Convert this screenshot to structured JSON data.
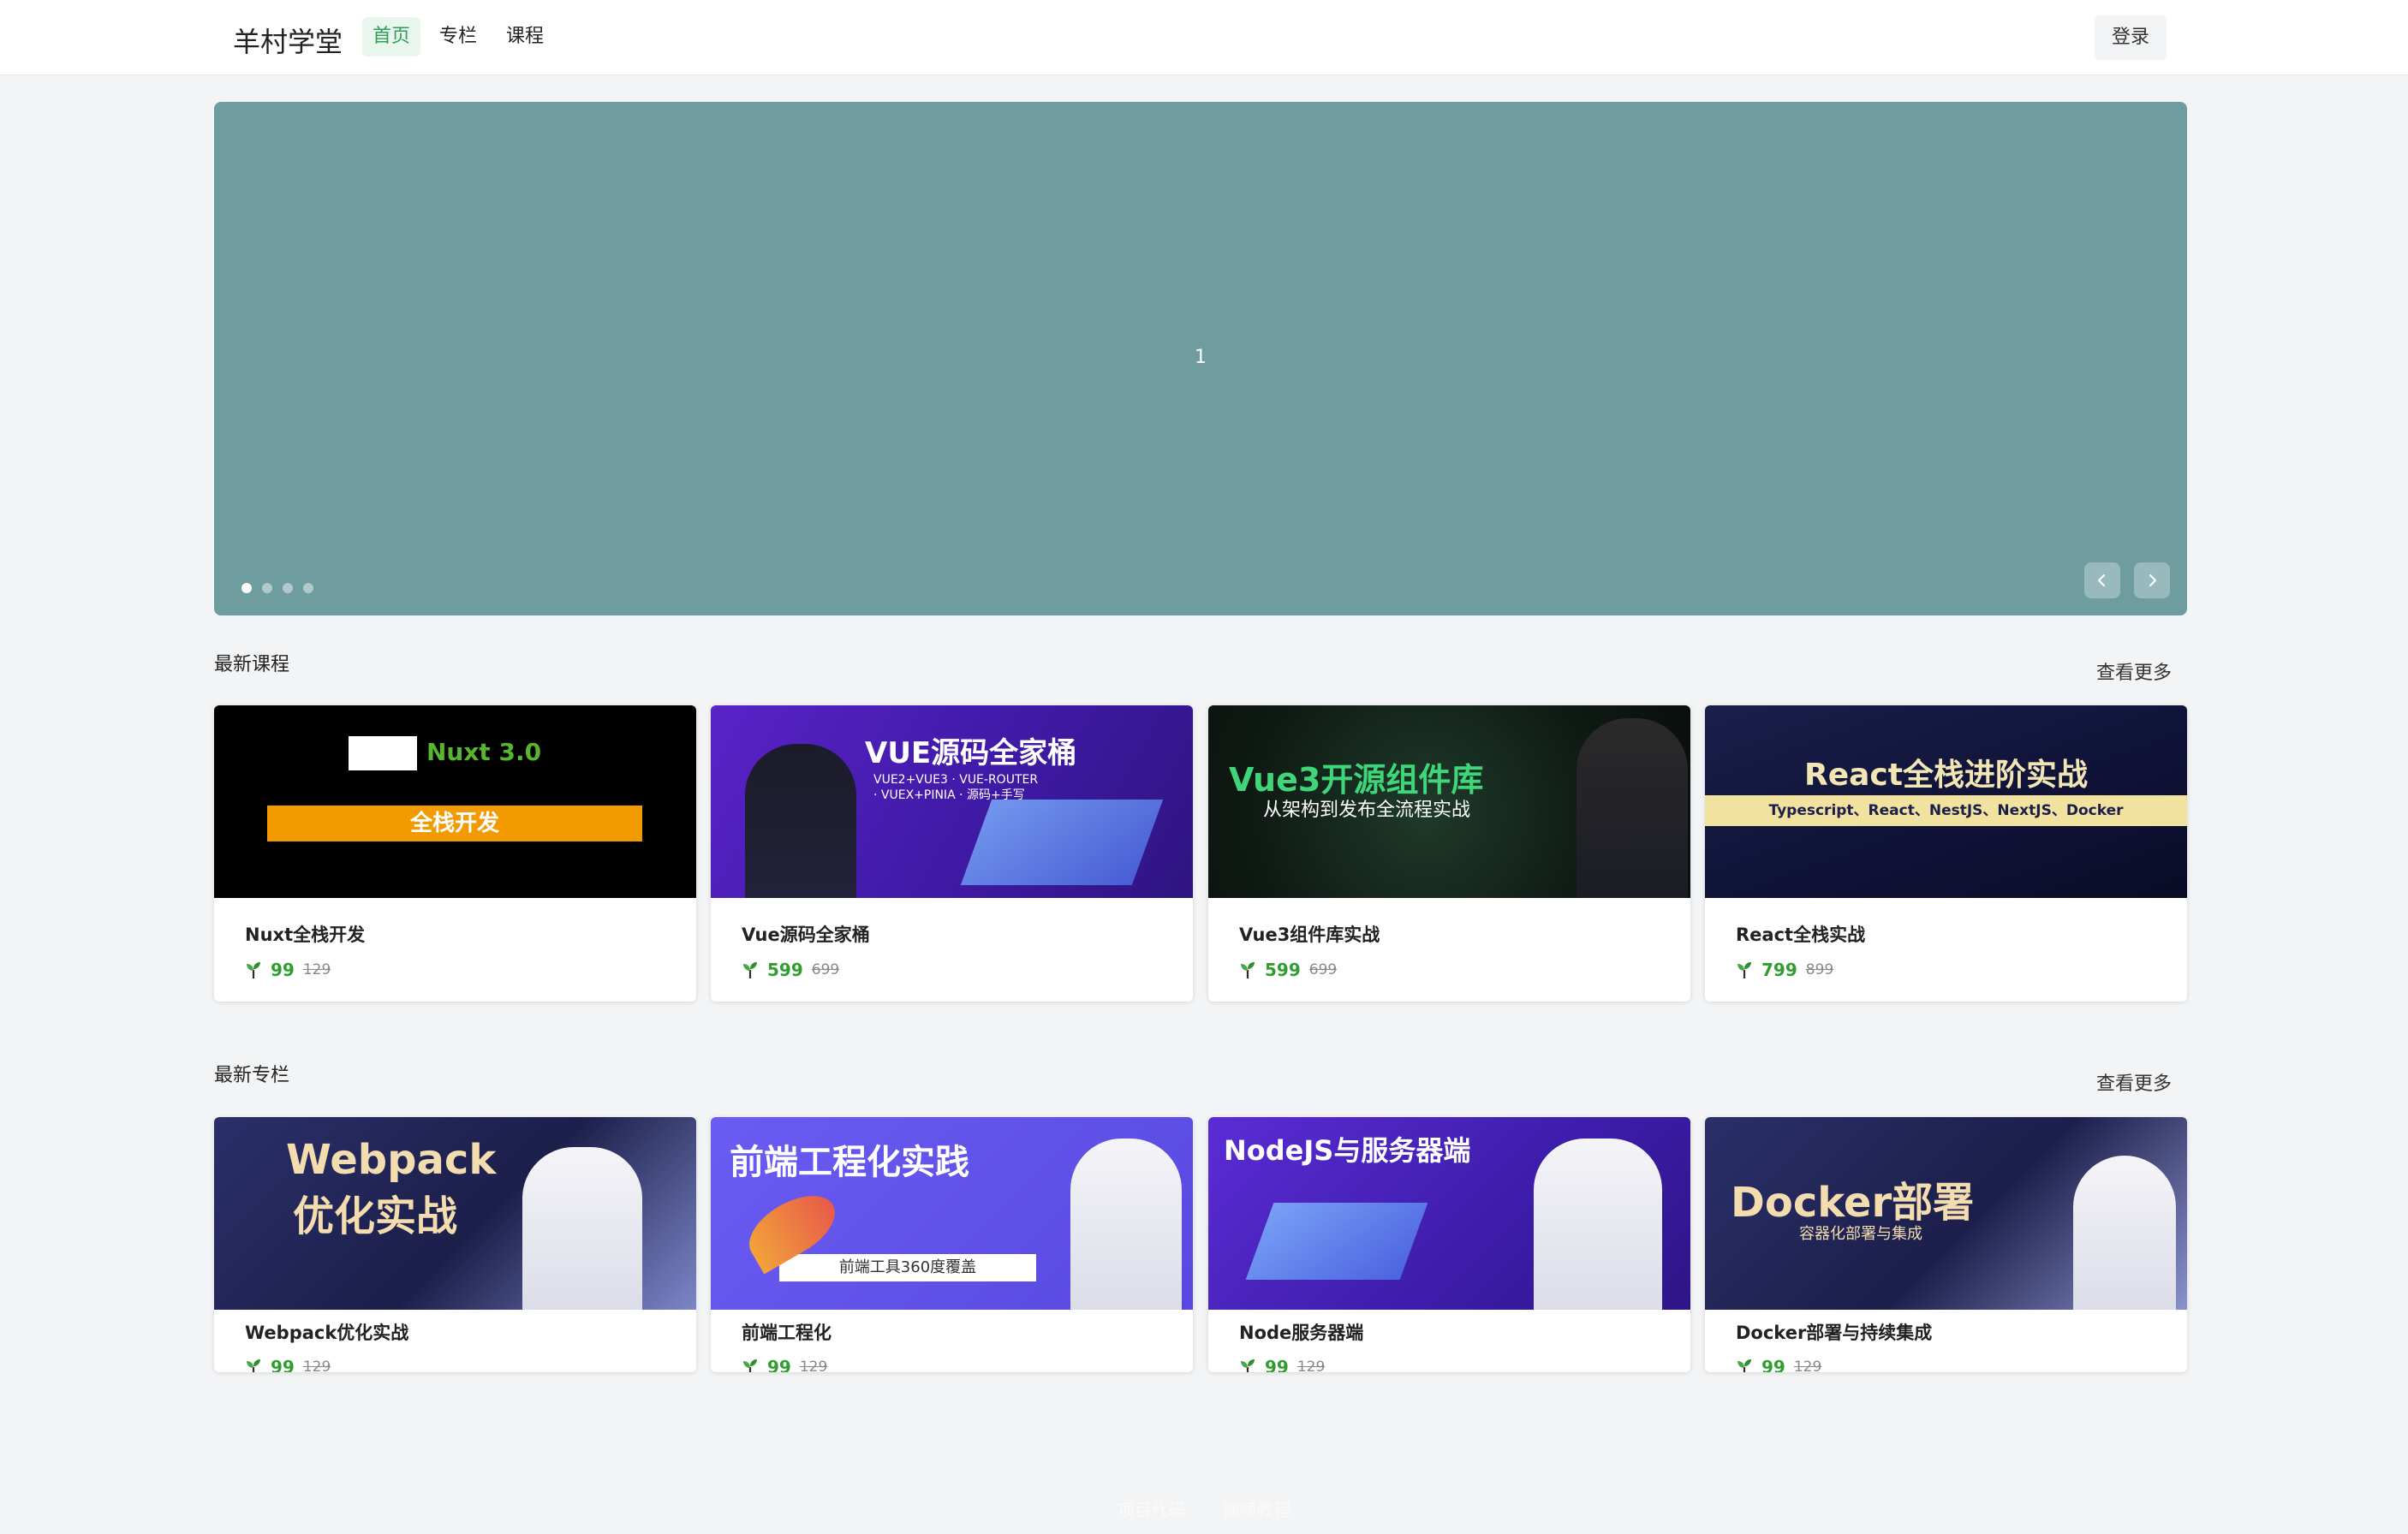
{
  "header": {
    "brand": "羊村学堂",
    "nav": [
      {
        "label": "首页",
        "active": true
      },
      {
        "label": "专栏",
        "active": false
      },
      {
        "label": "课程",
        "active": false
      }
    ],
    "login_label": "登录"
  },
  "carousel": {
    "slide_number": "1",
    "dot_count": 4,
    "active_dot": 0,
    "prev_icon": "chevron-left-icon",
    "next_icon": "chevron-right-icon",
    "background": "#6e9c9f"
  },
  "courses": {
    "title": "最新课程",
    "more_label": "查看更多",
    "items": [
      {
        "name": "Nuxt全栈开发",
        "price": "99",
        "old_price": "129",
        "thumb_line1": "Nuxt 3.0",
        "thumb_line2": "全栈开发"
      },
      {
        "name": "Vue源码全家桶",
        "price": "599",
        "old_price": "699",
        "thumb_line1": "VUE源码全家桶",
        "thumb_line2": "VUE2+VUE3 · VUE-ROUTER · VUEX+PINIA · 源码+手写"
      },
      {
        "name": "Vue3组件库实战",
        "price": "599",
        "old_price": "699",
        "thumb_line1": "Vue3开源组件库",
        "thumb_line2": "从架构到发布全流程实战"
      },
      {
        "name": "React全栈实战",
        "price": "799",
        "old_price": "899",
        "thumb_line1": "React全栈进阶实战",
        "thumb_line2": "Typescript、React、NestJS、NextJS、Docker"
      }
    ]
  },
  "columns": {
    "title": "最新专栏",
    "more_label": "查看更多",
    "items": [
      {
        "name": "Webpack优化实战",
        "price": "99",
        "old_price": "129",
        "thumb_line1": "Webpack",
        "thumb_line2": "优化实战"
      },
      {
        "name": "前端工程化",
        "price": "99",
        "old_price": "129",
        "thumb_line1": "前端工程化实践",
        "thumb_line2": "前端工具360度覆盖"
      },
      {
        "name": "Node服务器端",
        "price": "99",
        "old_price": "129",
        "thumb_line1": "NodeJS与服务器端",
        "thumb_line2": ""
      },
      {
        "name": "Docker部署与持续集成",
        "price": "99",
        "old_price": "129",
        "thumb_line1": "Docker部署",
        "thumb_line2": "容器化部署与集成"
      }
    ]
  },
  "footer": {
    "links": [
      "项目代码",
      "视频教程"
    ]
  },
  "colors": {
    "accent": "#2f9e57",
    "price": "#2f9e2f"
  }
}
